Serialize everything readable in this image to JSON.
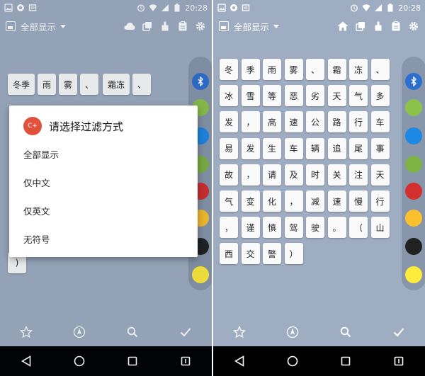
{
  "status_bar": {
    "time": "20:28"
  },
  "toolbar": {
    "title": "全部显示"
  },
  "left_keys": [
    "冬季",
    "雨",
    "雾",
    "、",
    "霜冻",
    "、"
  ],
  "left_bottom_key": ")",
  "dialog": {
    "logo_text": "C+",
    "title": "请选择过滤方式",
    "options": [
      "全部显示",
      "仅中文",
      "仅英文",
      "无符号"
    ]
  },
  "right_keys": [
    "冬",
    "季",
    "雨",
    "雾",
    "、",
    "霜",
    "冻",
    "、",
    "冰",
    "雪",
    "等",
    "恶",
    "劣",
    "天",
    "气",
    "多",
    "发",
    "，",
    "高",
    "速",
    "公",
    "路",
    "行",
    "车",
    "易",
    "发",
    "生",
    "车",
    "辆",
    "追",
    "尾",
    "事",
    "故",
    "，",
    "请",
    "及",
    "时",
    "关",
    "注",
    "天",
    "气",
    "变",
    "化",
    "，",
    "减",
    "速",
    "慢",
    "行",
    "，",
    "谨",
    "慎",
    "驾",
    "驶",
    "。",
    "（",
    "山",
    "西",
    "交",
    "警",
    "）"
  ],
  "sidebar_apps": [
    {
      "icon": "bluetooth-icon",
      "color": "#2d6fd0"
    },
    {
      "icon": "android-green-icon",
      "color": "#8bc34a"
    },
    {
      "icon": "browser-icon",
      "color": "#1e88e5"
    },
    {
      "icon": "android-icon",
      "color": "#7cb342"
    },
    {
      "icon": "pinterest-icon",
      "color": "#d32f2f"
    },
    {
      "icon": "check-icon",
      "color": "#fbc02d"
    },
    {
      "icon": "letter-w-icon",
      "color": "#212121"
    },
    {
      "icon": "yellow-circle-icon",
      "color": "#ffeb3b"
    }
  ]
}
